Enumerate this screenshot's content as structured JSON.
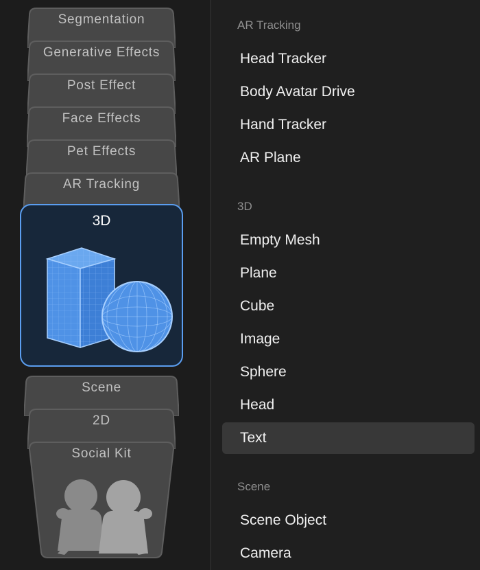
{
  "category_tabs": {
    "segmentation": "Segmentation",
    "generative_effects": "Generative Effects",
    "post_effect": "Post Effect",
    "face_effects": "Face Effects",
    "pet_effects": "Pet Effects",
    "ar_tracking": "AR Tracking",
    "three_d": "3D",
    "scene": "Scene",
    "two_d": "2D",
    "social_kit": "Social Kit"
  },
  "sections": {
    "ar_tracking": {
      "header": "AR Tracking",
      "items": [
        "Head Tracker",
        "Body Avatar Drive",
        "Hand Tracker",
        "AR Plane"
      ]
    },
    "three_d": {
      "header": "3D",
      "items": [
        "Empty Mesh",
        "Plane",
        "Cube",
        "Image",
        "Sphere",
        "Head",
        "Text"
      ]
    },
    "scene": {
      "header": "Scene",
      "items": [
        "Scene Object",
        "Camera"
      ]
    }
  },
  "selected_item": "Text",
  "colors": {
    "accent_blue": "#5b9ef0",
    "selected_row": "#383838",
    "card_fill": "#474747"
  },
  "icons": {
    "three_d_card": "cube-and-sphere-icon",
    "social_kit_card": "people-icon"
  }
}
